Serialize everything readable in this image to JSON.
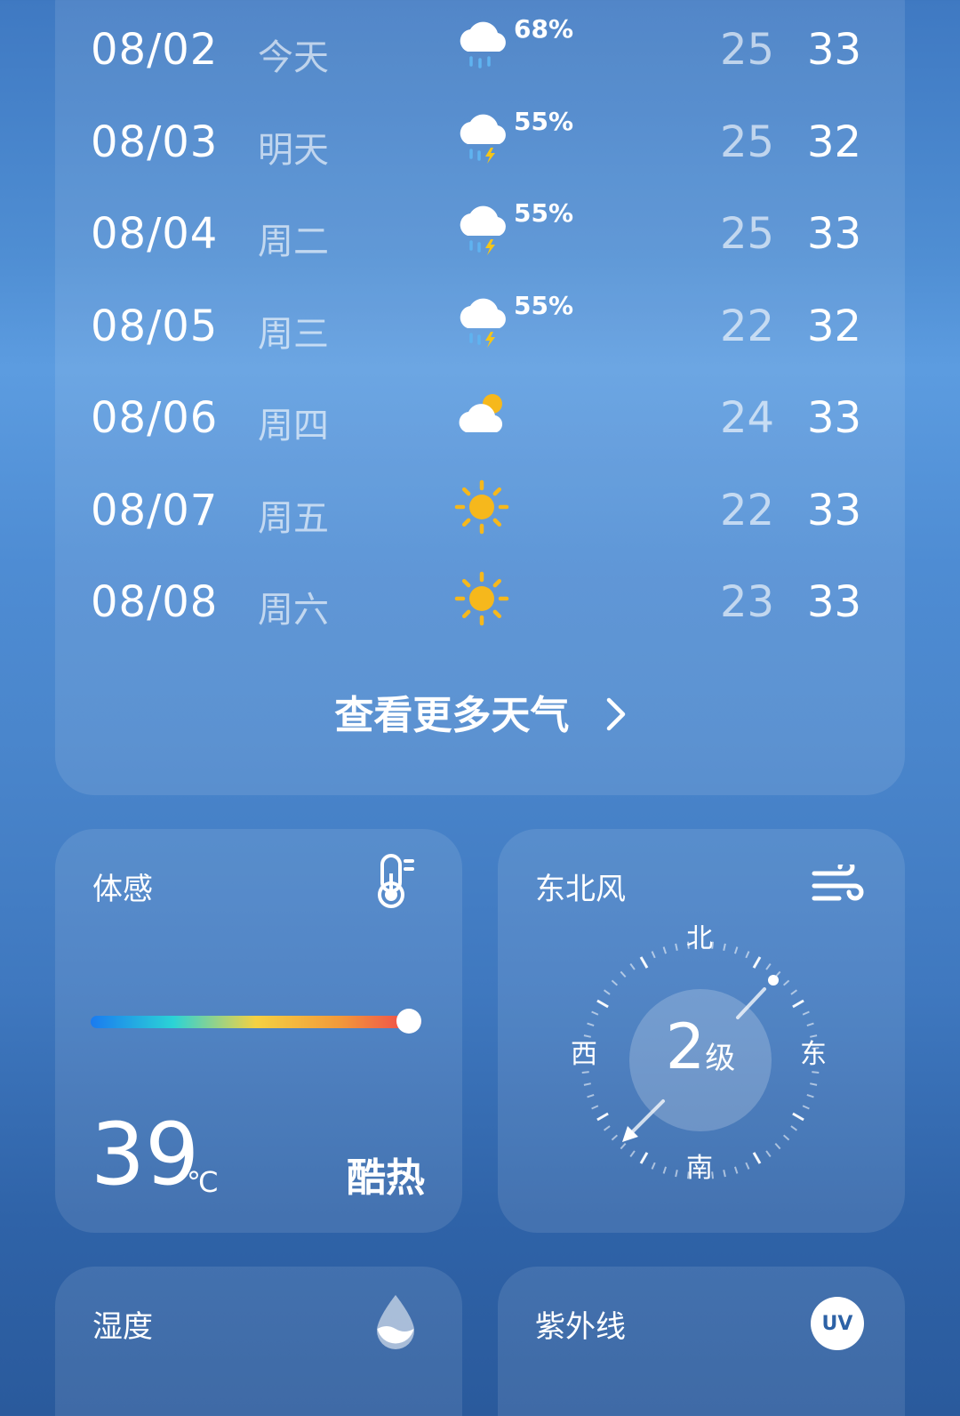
{
  "forecast": [
    {
      "date": "08/02",
      "day": "今天",
      "icon": "rain-cloud-icon",
      "precip": "68%",
      "low": "25",
      "high": "33"
    },
    {
      "date": "08/03",
      "day": "明天",
      "icon": "thunderstorm-icon",
      "precip": "55%",
      "low": "25",
      "high": "32"
    },
    {
      "date": "08/04",
      "day": "周二",
      "icon": "thunderstorm-icon",
      "precip": "55%",
      "low": "25",
      "high": "33"
    },
    {
      "date": "08/05",
      "day": "周三",
      "icon": "thunderstorm-icon",
      "precip": "55%",
      "low": "22",
      "high": "32"
    },
    {
      "date": "08/06",
      "day": "周四",
      "icon": "partly-cloudy-icon",
      "precip": "",
      "low": "24",
      "high": "33"
    },
    {
      "date": "08/07",
      "day": "周五",
      "icon": "sun-icon",
      "precip": "",
      "low": "22",
      "high": "33"
    },
    {
      "date": "08/08",
      "day": "周六",
      "icon": "sun-icon",
      "precip": "",
      "low": "23",
      "high": "33"
    }
  ],
  "more_weather_label": "查看更多天气",
  "feels_like": {
    "label": "体感",
    "value": "39",
    "unit": "℃",
    "description": "酷热",
    "level": 1.0
  },
  "wind": {
    "label": "东北风",
    "level_value": "2",
    "level_unit": "级",
    "north": "北",
    "south": "南",
    "east": "东",
    "west": "西",
    "direction_deg": 45
  },
  "humidity": {
    "label": "湿度"
  },
  "uv": {
    "label": "紫外线",
    "badge": "UV"
  },
  "colors": {
    "sun": "#f6b81c",
    "rain": "#5fb3f0",
    "bolt": "#f5c518"
  }
}
